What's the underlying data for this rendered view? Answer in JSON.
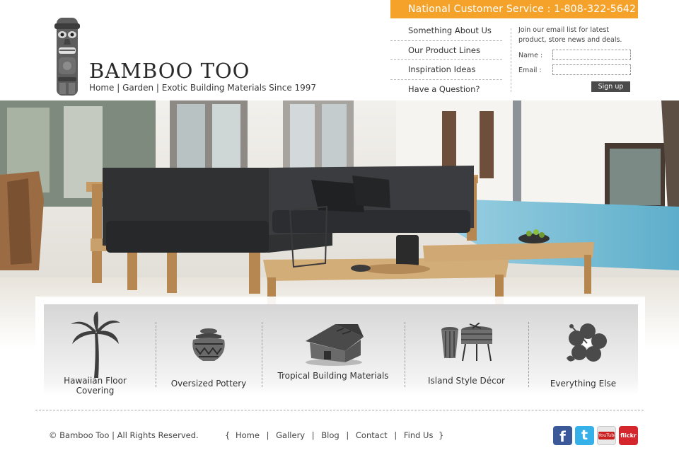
{
  "brand": {
    "name": "BAMBOO TOO",
    "tagline": "Home | Garden | Exotic Building Materials Since 1997",
    "logo_icon": "tiki-statue-icon"
  },
  "customer_service": {
    "text": "National Customer Service : 1-808-322-5642",
    "color": "#f5a22b"
  },
  "quick_links": [
    {
      "label": "Something About Us"
    },
    {
      "label": "Our Product Lines"
    },
    {
      "label": "Inspiration Ideas"
    },
    {
      "label": "Have a Question?"
    }
  ],
  "newsletter": {
    "intro": "Join our email list for latest product, store news and deals.",
    "name_label": "Name :",
    "email_label": "Email :",
    "signup_label": "Sign up"
  },
  "hero": {
    "scene": "outdoor-teak-sofa-poolside-photo"
  },
  "categories": [
    {
      "label": "Hawaiian Floor Covering",
      "icon": "palm-tree-icon"
    },
    {
      "label": "Oversized Pottery",
      "icon": "pottery-icon"
    },
    {
      "label": "Tropical Building Materials",
      "icon": "hut-icon"
    },
    {
      "label": "Island Style Décor",
      "icon": "drums-icon"
    },
    {
      "label": "Everything Else",
      "icon": "hibiscus-icon"
    }
  ],
  "footer": {
    "copyright": "© Bamboo Too | All Rights Reserved.",
    "nav_open": "{",
    "nav_close": "}",
    "nav": [
      "Home",
      "Gallery",
      "Blog",
      "Contact",
      "Find Us"
    ],
    "social": [
      {
        "name": "facebook-icon",
        "label": "f",
        "color": "#3b5998"
      },
      {
        "name": "twitter-icon",
        "label": "t",
        "color": "#35b0e8"
      },
      {
        "name": "youtube-icon",
        "label": "YouTube",
        "color": "#cc1f1f"
      },
      {
        "name": "flickr-icon",
        "label": "flickr",
        "color": "#d4262c"
      }
    ]
  }
}
